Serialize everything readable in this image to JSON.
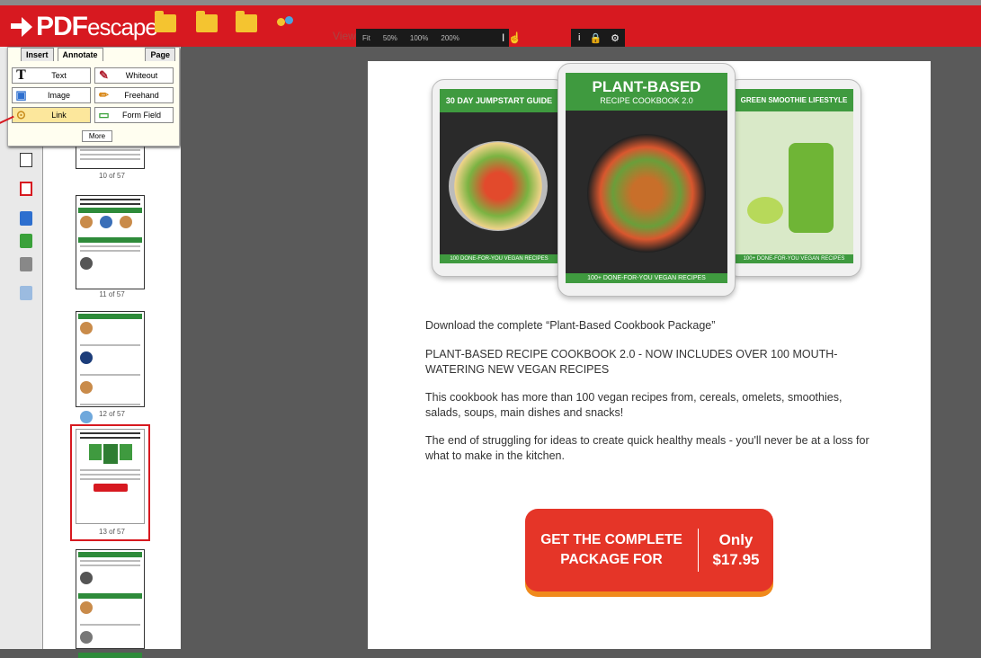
{
  "app": {
    "logo_bold": "PDF",
    "logo_light": "escape"
  },
  "toolbar": {
    "view_label": "View",
    "zoom": [
      "Fit",
      "50%",
      "100%",
      "200%"
    ],
    "brand_color": "#d71920"
  },
  "annotate_panel": {
    "tabs": [
      "Insert",
      "Annotate",
      "Page"
    ],
    "active_tab": "Annotate",
    "buttons": {
      "text": "Text",
      "whiteout": "Whiteout",
      "image": "Image",
      "freehand": "Freehand",
      "link": "Link",
      "form_field": "Form Field"
    },
    "more": "More"
  },
  "thumbnails": {
    "labels": [
      "10 of 57",
      "11 of 57",
      "12 of 57",
      "13 of 57"
    ],
    "selected": "13 of 57"
  },
  "document": {
    "covers": {
      "left_title": "30 DAY JUMPSTART GUIDE",
      "left_footer": "100 DONE-FOR-YOU VEGAN RECIPES",
      "center_title": "PLANT-BASED",
      "center_sub": "RECIPE COOKBOOK 2.0",
      "center_footer": "100+ DONE-FOR-YOU VEGAN RECIPES",
      "right_title": "GREEN SMOOTHIE LIFESTYLE",
      "right_footer": "100+ DONE-FOR-YOU VEGAN RECIPES"
    },
    "line1": "Download the complete “Plant-Based Cookbook Package”",
    "line2": "PLANT-BASED RECIPE COOKBOOK 2.0 - NOW INCLUDES OVER 100 MOUTH-WATERING NEW VEGAN RECIPES",
    "line3": "This cookbook has more than 100 vegan recipes from, cereals, omelets, smoothies, salads, soups, main dishes and snacks!",
    "line4": "The end of struggling for ideas to create quick healthy meals - you'll never be at a loss for what to make in the kitchen.",
    "cta_left_1": "GET THE COMPLETE",
    "cta_left_2": "PACKAGE FOR",
    "cta_right_1": "Only",
    "cta_right_2": "$17.95"
  }
}
